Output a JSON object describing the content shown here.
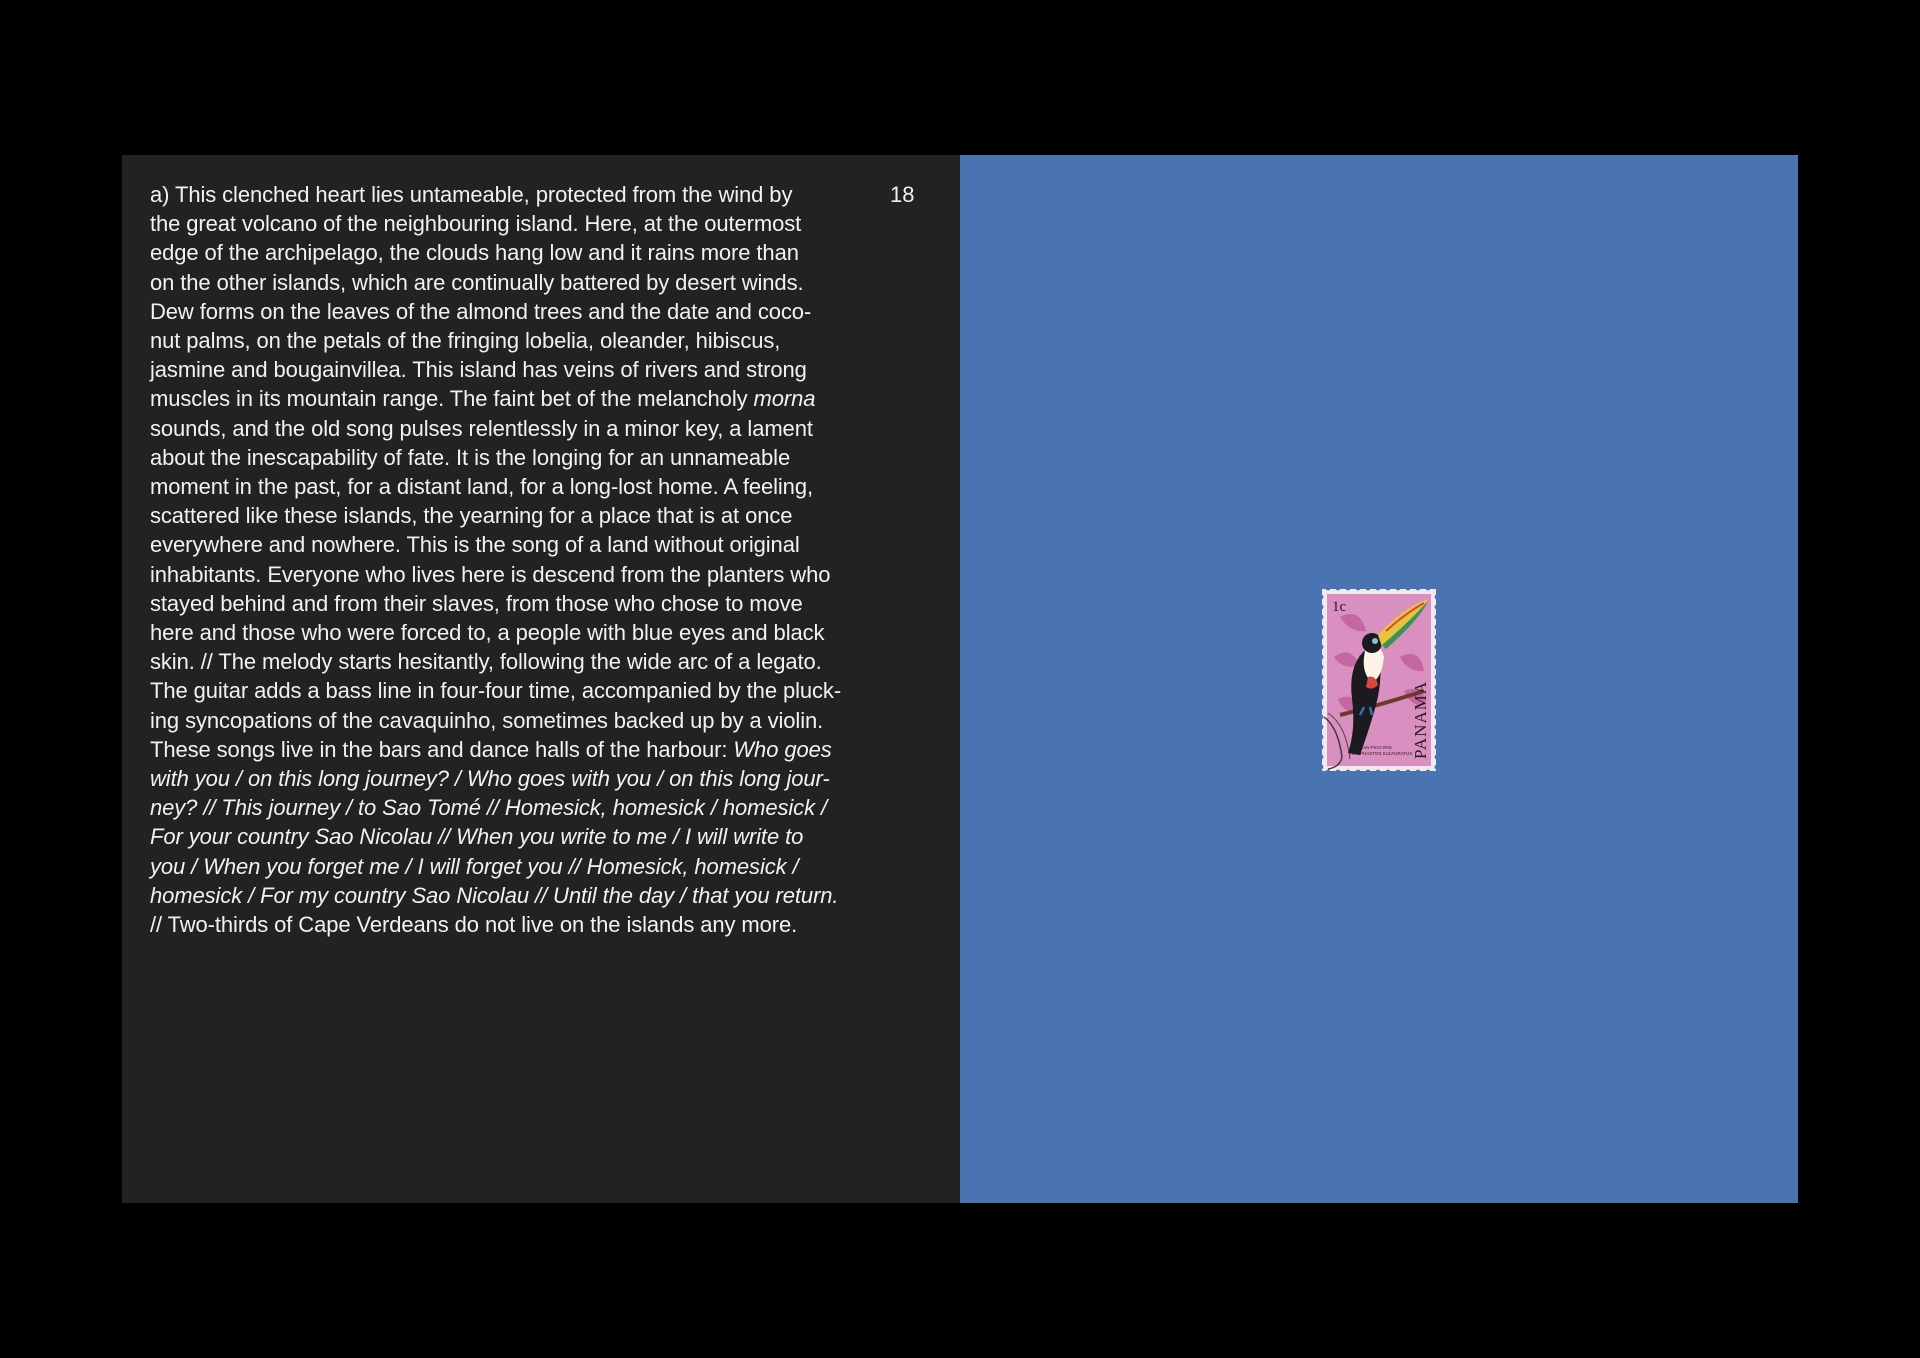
{
  "page": {
    "number": "18",
    "background": "#000000",
    "left_page_color": "#222222",
    "right_page_color": "#4a73b1"
  },
  "text_lines": [
    {
      "segments": [
        {
          "text": "a) This clenched heart lies untameable, protected from the wind by",
          "italic": false
        }
      ]
    },
    {
      "segments": [
        {
          "text": "the great volcano of the neighbouring island. Here, at the outermost",
          "italic": false
        }
      ]
    },
    {
      "segments": [
        {
          "text": "edge of the archipelago, the clouds hang low and it rains more than",
          "italic": false
        }
      ]
    },
    {
      "segments": [
        {
          "text": "on the other islands, which are continually battered by desert winds.",
          "italic": false
        }
      ]
    },
    {
      "segments": [
        {
          "text": "Dew forms on the leaves of the almond trees and the date and coco-",
          "italic": false
        }
      ]
    },
    {
      "segments": [
        {
          "text": "nut palms, on the petals of the fringing lobelia, oleander, hibiscus,",
          "italic": false
        }
      ]
    },
    {
      "segments": [
        {
          "text": "jasmine and bougainvillea. This island has veins of rivers and strong",
          "italic": false
        }
      ]
    },
    {
      "segments": [
        {
          "text": "muscles in its mountain range. The faint bet of the melancholy ",
          "italic": false
        },
        {
          "text": "morna",
          "italic": true
        }
      ]
    },
    {
      "segments": [
        {
          "text": "sounds, and the old song pulses relentlessly in a minor key, a lament",
          "italic": false
        }
      ]
    },
    {
      "segments": [
        {
          "text": "about the inescapability of fate. It is the longing for an unnameable",
          "italic": false
        }
      ]
    },
    {
      "segments": [
        {
          "text": "moment in the past, for a distant land, for a long-lost home. A feeling,",
          "italic": false
        }
      ]
    },
    {
      "segments": [
        {
          "text": "scattered like these islands, the yearning for a place that is at once",
          "italic": false
        }
      ]
    },
    {
      "segments": [
        {
          "text": "everywhere and nowhere. This is the song of a land without original",
          "italic": false
        }
      ]
    },
    {
      "segments": [
        {
          "text": "inhabitants. Everyone who lives here is descend from the planters who",
          "italic": false
        }
      ]
    },
    {
      "segments": [
        {
          "text": "stayed behind and from their slaves, from those who chose to move",
          "italic": false
        }
      ]
    },
    {
      "segments": [
        {
          "text": "here and those who were forced to, a people with blue eyes and black",
          "italic": false
        }
      ]
    },
    {
      "segments": [
        {
          "text": "skin. // The melody starts hesitantly, following the wide arc of a legato.",
          "italic": false
        }
      ]
    },
    {
      "segments": [
        {
          "text": "The guitar adds a bass line in four-four time, accompanied by the pluck-",
          "italic": false
        }
      ]
    },
    {
      "segments": [
        {
          "text": "ing syncopations of the cavaquinho, sometimes backed up by a violin.",
          "italic": false
        }
      ]
    },
    {
      "segments": [
        {
          "text": "These songs live in the bars and dance halls of the harbour: ",
          "italic": false
        },
        {
          "text": "Who goes",
          "italic": true
        }
      ]
    },
    {
      "segments": [
        {
          "text": "with you / on this long journey? / Who goes with you / on this long jour-",
          "italic": true
        }
      ]
    },
    {
      "segments": [
        {
          "text": "ney? // This journey / to Sao Tomé // Homesick, homesick / homesick /",
          "italic": true
        }
      ]
    },
    {
      "segments": [
        {
          "text": "For your country Sao Nicolau // When you write to me / I will write to",
          "italic": true
        }
      ]
    },
    {
      "segments": [
        {
          "text": "you / When you forget me / I will forget you // Homesick, homesick /",
          "italic": true
        }
      ]
    },
    {
      "segments": [
        {
          "text": "homesick / For my country Sao Nicolau // Until the day / that you return.",
          "italic": true
        }
      ]
    },
    {
      "segments": [
        {
          "text": "// Two-thirds of Cape Verdeans do not live on the islands any more.",
          "italic": false
        }
      ]
    }
  ],
  "stamp": {
    "denomination": "1c",
    "country": "PANAMA",
    "caption_line1": "TUCAN PICO IRIS",
    "caption_line2": "RAMPHASTOS SULFURATUS",
    "colors": {
      "paper": "#f1e9ee",
      "background": "#d98fbf",
      "toucan_body": "#1b1b1f",
      "beak": "#e6c43c"
    }
  }
}
